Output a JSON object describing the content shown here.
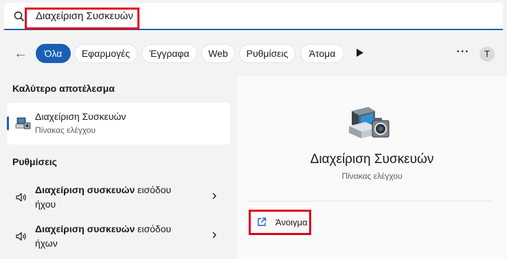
{
  "search": {
    "query": "Διαχείριση Συσκευών",
    "icon": "search-icon"
  },
  "filters": {
    "tabs": [
      {
        "label": "Όλα",
        "active": true
      },
      {
        "label": "Εφαρμογές",
        "active": false
      },
      {
        "label": "Έγγραφα",
        "active": false
      },
      {
        "label": "Web",
        "active": false
      },
      {
        "label": "Ρυθμίσεις",
        "active": false
      },
      {
        "label": "Άτομα",
        "active": false
      }
    ],
    "more_label": "···",
    "avatar_letter": "T"
  },
  "best_match": {
    "section_title": "Καλύτερο αποτέλεσμα",
    "title": "Διαχείριση Συσκευών",
    "subtitle": "Πίνακας ελέγχου"
  },
  "settings": {
    "section_title": "Ρυθμίσεις",
    "items": [
      {
        "bold": "Διαχείριση συσκευών",
        "rest": " εισόδου",
        "line2": "ήχου"
      },
      {
        "bold": "Διαχείριση συσκευών",
        "rest": " εισόδου",
        "line2": "ήχων"
      }
    ]
  },
  "detail": {
    "title": "Διαχείριση Συσκευών",
    "subtitle": "Πίνακας ελέγχου",
    "open_label": "Άνοιγμα"
  },
  "colors": {
    "accent": "#1a5fb4",
    "highlight": "#e0001b"
  }
}
